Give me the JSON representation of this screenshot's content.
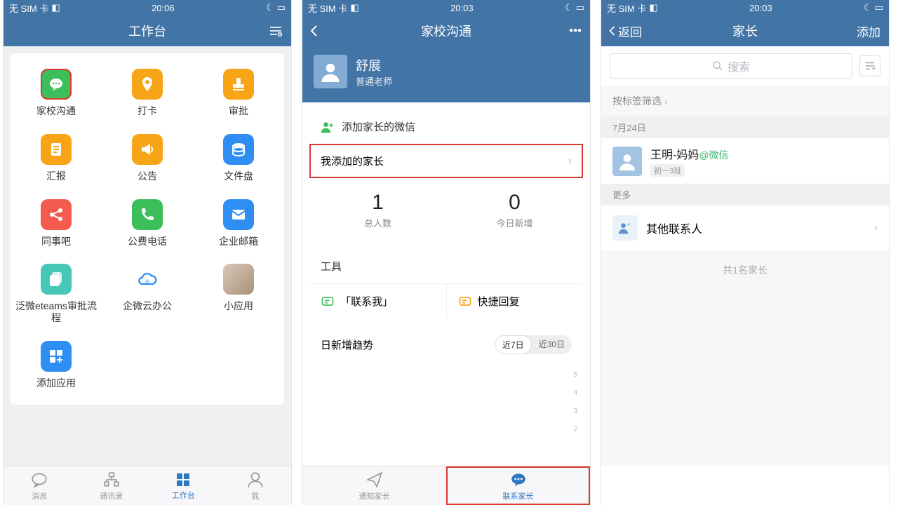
{
  "status": {
    "sim": "无 SIM 卡",
    "wifi": "✓"
  },
  "screen1": {
    "time": "20:06",
    "title": "工作台",
    "apps": [
      {
        "label": "家校沟通",
        "color": "#3cbf5a",
        "icon": "chat",
        "hl": true
      },
      {
        "label": "打卡",
        "color": "#f7a417",
        "icon": "pin"
      },
      {
        "label": "审批",
        "color": "#f7a417",
        "icon": "stamp"
      },
      {
        "label": "汇报",
        "color": "#f7a417",
        "icon": "doc"
      },
      {
        "label": "公告",
        "color": "#f7a417",
        "icon": "horn"
      },
      {
        "label": "文件盘",
        "color": "#2f8ef4",
        "icon": "disk"
      },
      {
        "label": "同事吧",
        "color": "#f45b4f",
        "icon": "share"
      },
      {
        "label": "公费电话",
        "color": "#3cbf5a",
        "icon": "phone"
      },
      {
        "label": "企业邮箱",
        "color": "#2f8ef4",
        "icon": "mail"
      },
      {
        "label": "泛微eteams审批流程",
        "color": "#47c7b7",
        "icon": "copy"
      },
      {
        "label": "企微云办公",
        "color": "#fff",
        "icon": "cloud",
        "fg": "#2f8ef4"
      },
      {
        "label": "小应用",
        "color": "#fff",
        "icon": "img"
      },
      {
        "label": "添加应用",
        "color": "#2f8ef4",
        "icon": "add"
      }
    ],
    "tabs": [
      {
        "label": "消息",
        "icon": "chat-o"
      },
      {
        "label": "通讯录",
        "icon": "org"
      },
      {
        "label": "工作台",
        "icon": "grid",
        "active": true
      },
      {
        "label": "我",
        "icon": "user"
      }
    ]
  },
  "screen2": {
    "time": "20:03",
    "title": "家校沟通",
    "profile": {
      "name": "舒展",
      "role": "普通老师"
    },
    "addRow": "添加家长的微信",
    "myAdded": "我添加的家长",
    "stats": [
      {
        "n": "1",
        "l": "总人数"
      },
      {
        "n": "0",
        "l": "今日新增"
      }
    ],
    "toolsHdr": "工具",
    "tools": [
      {
        "l": "「联系我」",
        "c": "#3cbf5a"
      },
      {
        "l": "快捷回复",
        "c": "#f7a417"
      }
    ],
    "trendHdr": "日新增趋势",
    "seg": [
      "近7日",
      "近30日"
    ],
    "chart_y": [
      "5",
      "4",
      "3",
      "2"
    ],
    "tabs": [
      {
        "label": "通知家长",
        "icon": "send"
      },
      {
        "label": "联系家长",
        "icon": "chat-f",
        "active": true,
        "hl": true
      }
    ]
  },
  "screen3": {
    "time": "20:03",
    "back": "返回",
    "title": "家长",
    "add": "添加",
    "searchPh": "搜索",
    "filter": "按标签筛选",
    "dateHdr": "7月24日",
    "contact": {
      "name": "王明-妈妈",
      "tag": "@微信",
      "cls": "初一3班"
    },
    "moreHdr": "更多",
    "other": "其他联系人",
    "count": "共1名家长"
  },
  "chart_data": {
    "type": "line",
    "title": "日新增趋势",
    "ylabel": "",
    "xlabel": "",
    "ylim": [
      0,
      5
    ],
    "categories": [],
    "values": [],
    "range_options": [
      "近7日",
      "近30日"
    ],
    "selected_range": "近7日"
  }
}
